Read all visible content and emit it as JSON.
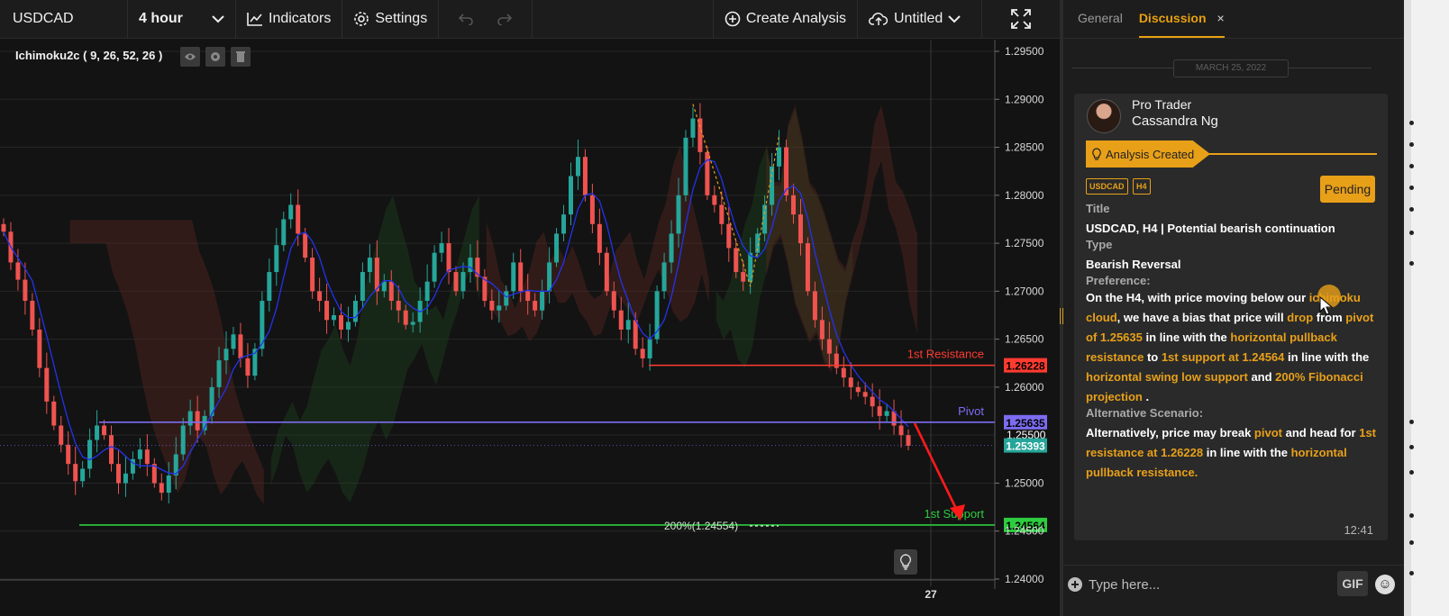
{
  "toolbar": {
    "symbol": "USDCAD",
    "interval": "4 hour",
    "indicators_label": "Indicators",
    "settings_label": "Settings",
    "create_label": "Create Analysis",
    "layout_name": "Untitled"
  },
  "indicator": {
    "label": "Ichimoku2c ( 9, 26, 52, 26 )"
  },
  "chart_data": {
    "type": "candlestick",
    "symbol": "USDCAD",
    "interval": "4 hour",
    "ylim": [
      1.24,
      1.295
    ],
    "y_ticks": [
      "1.29500",
      "1.29000",
      "1.28500",
      "1.28000",
      "1.27500",
      "1.27000",
      "1.26500",
      "1.26000",
      "1.25500",
      "1.25000",
      "1.24500",
      "1.24000"
    ],
    "x_tick_label": "27",
    "levels": [
      {
        "name": "1st Resistance",
        "value": 1.26228,
        "price_label": "1.26228",
        "color": "#ff3b30"
      },
      {
        "name": "Pivot",
        "value": 1.25635,
        "price_label": "1.25635",
        "color": "#7b6cf0"
      },
      {
        "name": "1st Support",
        "value": 1.24564,
        "price_label": "1.24564",
        "color": "#2ecc40"
      }
    ],
    "current_price": {
      "value": 1.25393,
      "price_label": "1.25393",
      "color": "#26a69a"
    },
    "prev_close_label": "1.25500",
    "fib_label": "200%(1.24554)",
    "close_path": [
      1.2762,
      1.273,
      1.2712,
      1.269,
      1.266,
      1.262,
      1.2585,
      1.256,
      1.254,
      1.252,
      1.2502,
      1.2515,
      1.2545,
      1.256,
      1.255,
      1.252,
      1.25,
      1.251,
      1.2525,
      1.2535,
      1.252,
      1.25,
      1.249,
      1.2508,
      1.253,
      1.256,
      1.2575,
      1.2555,
      1.257,
      1.26,
      1.2628,
      1.264,
      1.2655,
      1.263,
      1.2612,
      1.264,
      1.269,
      1.272,
      1.2748,
      1.2775,
      1.279,
      1.276,
      1.2735,
      1.27,
      1.269,
      1.267,
      1.2675,
      1.266,
      1.2668,
      1.269,
      1.272,
      1.2735,
      1.27,
      1.271,
      1.269,
      1.268,
      1.2665,
      1.2668,
      1.269,
      1.271,
      1.274,
      1.275,
      1.272,
      1.27,
      1.272,
      1.2735,
      1.2715,
      1.269,
      1.268,
      1.2685,
      1.27,
      1.273,
      1.27,
      1.269,
      1.268,
      1.27,
      1.273,
      1.276,
      1.278,
      1.282,
      1.284,
      1.28,
      1.277,
      1.274,
      1.27,
      1.268,
      1.266,
      1.267,
      1.264,
      1.263,
      1.265,
      1.27,
      1.273,
      1.276,
      1.28,
      1.286,
      1.288,
      1.2845,
      1.28,
      1.279,
      1.277,
      1.2745,
      1.272,
      1.271,
      1.274,
      1.276,
      1.279,
      1.283,
      1.285,
      1.28,
      1.278,
      1.275,
      1.27,
      1.267,
      1.265,
      1.2635,
      1.262,
      1.261,
      1.26,
      1.2595,
      1.259,
      1.258,
      1.257,
      1.2575,
      1.256,
      1.255,
      1.2539
    ]
  },
  "panel": {
    "tabs": [
      "General",
      "Discussion"
    ],
    "close_symbol": "×",
    "date": "MARCH 25, 2022",
    "author_role": "Pro Trader",
    "author_name": "Cassandra Ng",
    "banner": "Analysis Created",
    "tags": [
      "USDCAD",
      "H4"
    ],
    "status": "Pending",
    "title_label": "Title",
    "title_value": "USDCAD, H4 | Potential bearish continuation",
    "type_label": "Type",
    "type_value": "Bearish Reversal",
    "preference_label": "Preference:",
    "preference_segments": [
      {
        "t": "On the H4, with price moving below our ",
        "h": false
      },
      {
        "t": "ichimoku cloud",
        "h": true
      },
      {
        "t": ", we have a bias that price will ",
        "h": false
      },
      {
        "t": "drop",
        "h": true
      },
      {
        "t": " from ",
        "h": false
      },
      {
        "t": "pivot of 1.25635",
        "h": true
      },
      {
        "t": " in line with the ",
        "h": false
      },
      {
        "t": "horizontal pullback resistance",
        "h": true
      },
      {
        "t": "  to ",
        "h": false
      },
      {
        "t": "1st support at 1.24564",
        "h": true
      },
      {
        "t": " in line with the ",
        "h": false
      },
      {
        "t": "horizontal swing low support",
        "h": true
      },
      {
        "t": " and ",
        "h": false
      },
      {
        "t": "200% Fibonacci projection",
        "h": true
      },
      {
        "t": " .",
        "h": false
      }
    ],
    "alt_label": "Alternative Scenario:",
    "alt_segments": [
      {
        "t": "Alternatively, price may break ",
        "h": false
      },
      {
        "t": "pivot",
        "h": true
      },
      {
        "t": " and head for ",
        "h": false
      },
      {
        "t": "1st resistance at 1.26228",
        "h": true
      },
      {
        "t": " in line with the ",
        "h": false
      },
      {
        "t": "horizontal pullback resistance.",
        "h": true
      }
    ],
    "time": "12:41",
    "chat_placeholder": "Type here...",
    "gif_label": "GIF"
  }
}
